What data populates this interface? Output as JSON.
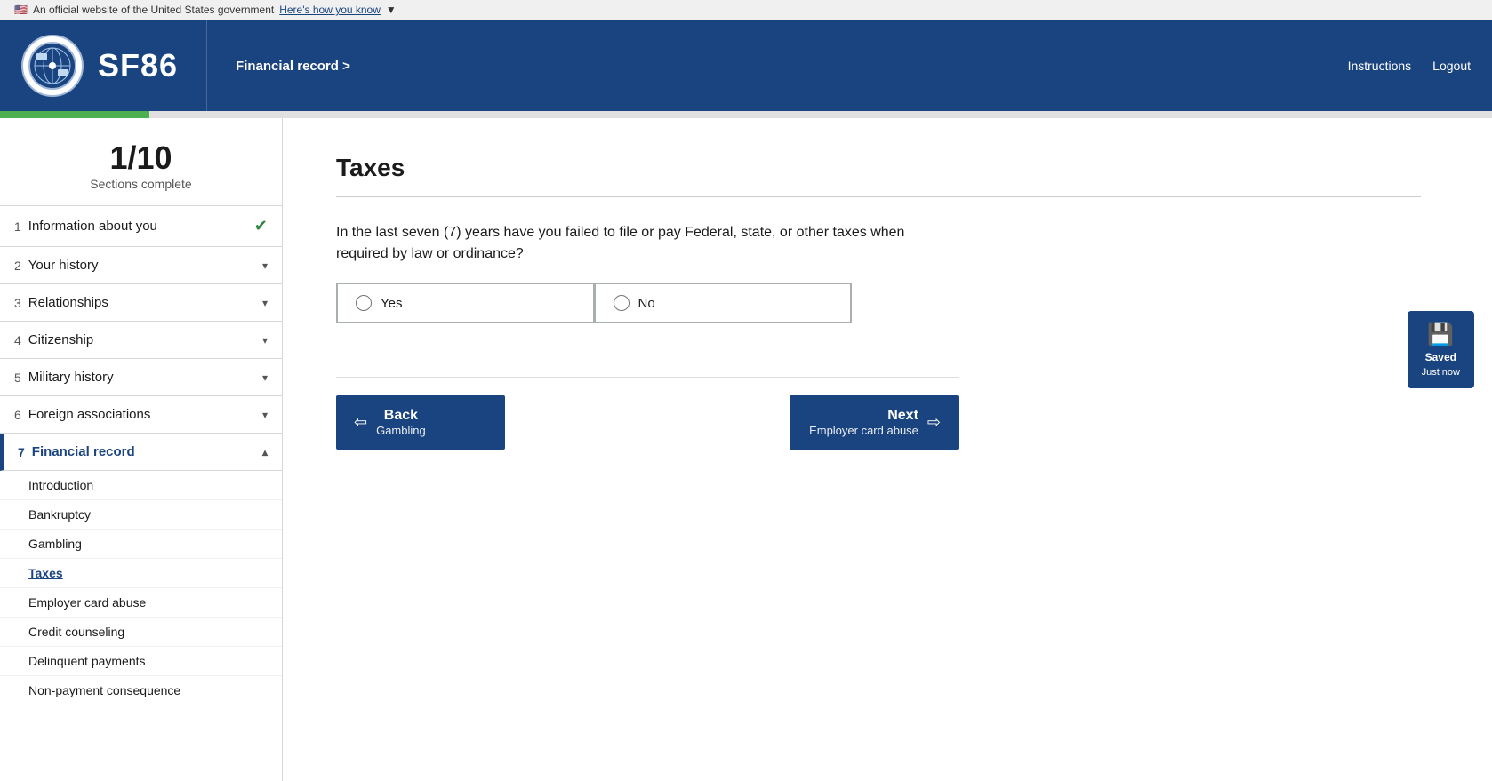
{
  "govBanner": {
    "flag": "🇺🇸",
    "text": "An official website of the United States government",
    "linkText": "Here's how you know"
  },
  "header": {
    "title": "SF86",
    "breadcrumb": "Financial record >",
    "nav": {
      "instructions": "Instructions",
      "logout": "Logout"
    }
  },
  "progress": {
    "current": "1/10",
    "label": "Sections complete",
    "barPercent": "10%"
  },
  "sidebar": {
    "items": [
      {
        "num": "1",
        "label": "Information about you",
        "hasCheck": true,
        "hasChevron": true
      },
      {
        "num": "2",
        "label": "Your history",
        "hasCheck": false,
        "hasChevron": true
      },
      {
        "num": "3",
        "label": "Relationships",
        "hasCheck": false,
        "hasChevron": true
      },
      {
        "num": "4",
        "label": "Citizenship",
        "hasCheck": false,
        "hasChevron": true
      },
      {
        "num": "5",
        "label": "Military history",
        "hasCheck": false,
        "hasChevron": true
      },
      {
        "num": "6",
        "label": "Foreign associations",
        "hasCheck": false,
        "hasChevron": true
      },
      {
        "num": "7",
        "label": "Financial record",
        "hasCheck": false,
        "hasChevron": true,
        "active": true
      }
    ],
    "subItems": [
      {
        "label": "Introduction",
        "active": false
      },
      {
        "label": "Bankruptcy",
        "active": false
      },
      {
        "label": "Gambling",
        "active": false
      },
      {
        "label": "Taxes",
        "active": true
      },
      {
        "label": "Employer card abuse",
        "active": false
      },
      {
        "label": "Credit counseling",
        "active": false
      },
      {
        "label": "Delinquent payments",
        "active": false
      },
      {
        "label": "Non-payment consequence",
        "active": false
      }
    ]
  },
  "main": {
    "title": "Taxes",
    "question": "In the last seven (7) years have you failed to file or pay Federal, state, or other taxes when required by law or ordinance?",
    "options": [
      {
        "id": "yes",
        "label": "Yes"
      },
      {
        "id": "no",
        "label": "No"
      }
    ]
  },
  "navigation": {
    "back": {
      "primary": "Back",
      "secondary": "Gambling"
    },
    "next": {
      "primary": "Next",
      "secondary": "Employer card abuse"
    }
  },
  "saveIndicator": {
    "icon": "💾",
    "label": "Saved",
    "time": "Just now"
  }
}
